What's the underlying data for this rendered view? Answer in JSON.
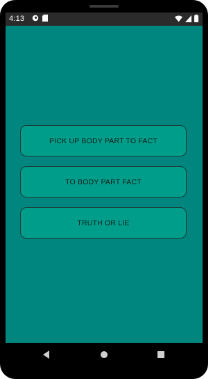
{
  "status_bar": {
    "time": "4:13",
    "left_icons": [
      "app-notification-icon",
      "sd-card-icon"
    ],
    "right_icons": [
      "wifi-icon",
      "cellular-signal-icon",
      "battery-icon"
    ]
  },
  "colors": {
    "screen_background": "#00857f",
    "button_background": "#009e8a",
    "button_border": "#1d3b37"
  },
  "menu": {
    "buttons": [
      {
        "label": "PICK UP BODY PART TO FACT"
      },
      {
        "label": "TO BODY PART FACT"
      },
      {
        "label": "TRUTH OR LIE"
      }
    ]
  },
  "nav_bar": {
    "icons": [
      "back-icon",
      "home-icon",
      "recents-icon"
    ]
  }
}
